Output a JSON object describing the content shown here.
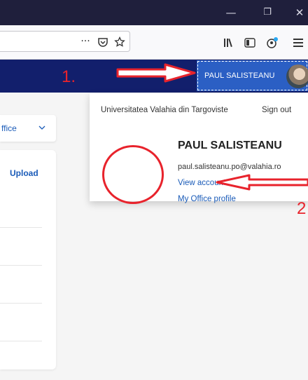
{
  "browser": {
    "window_controls": {
      "minimize": "—",
      "restore": "❐",
      "close": "✕"
    },
    "toolbar": {
      "more": "···",
      "pocket_icon": "pocket-icon",
      "bookmark_icon": "star-icon",
      "library_icon": "library-icon",
      "sidebar_icon": "sidebar-icon",
      "extension_icon": "extension-icon",
      "menu_icon": "hamburger-icon"
    }
  },
  "annotations": {
    "step1": "1.",
    "step2": "2"
  },
  "header": {
    "user_button_label": "PAUL SALISTEANU"
  },
  "background": {
    "office_button": "ffice",
    "upload_label": "Upload"
  },
  "account_panel": {
    "organization": "Universitatea Valahia din Targoviste",
    "sign_out": "Sign out",
    "name": "PAUL SALISTEANU",
    "email": "paul.salisteanu.po@valahia.ro",
    "view_account": "View account",
    "office_profile": "My Office profile"
  },
  "colors": {
    "titlebar": "#1f1f3c",
    "o365_header": "#121f6c",
    "user_button": "#2b5fc4",
    "annotation_red": "#e8232c",
    "link_blue": "#1a5bb8"
  }
}
